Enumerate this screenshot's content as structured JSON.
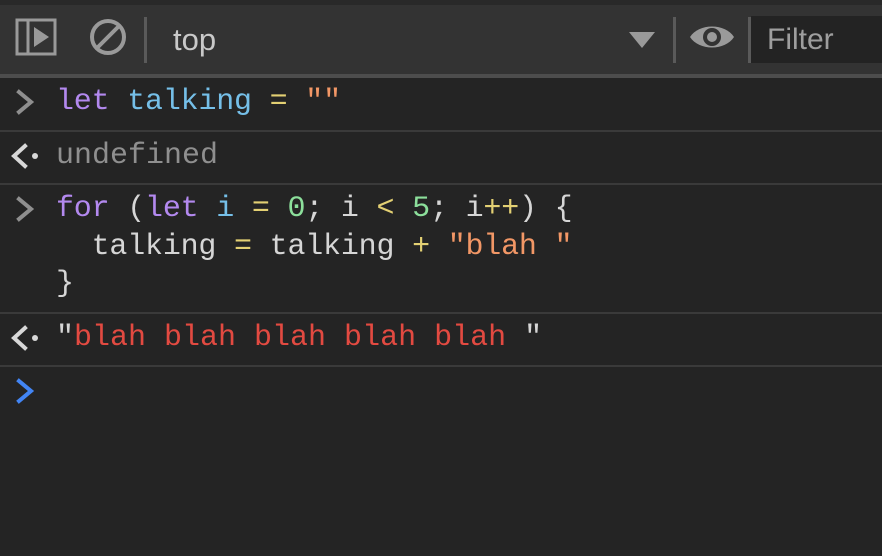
{
  "toolbar": {
    "sidebar_toggle": {
      "name": "Show console sidebar",
      "icon": "panel-play-icon"
    },
    "clear_console": {
      "name": "Clear console",
      "icon": "clear-console-icon"
    },
    "context_selector": {
      "value": "top",
      "icon": "chevron-down-icon"
    },
    "live_expression": {
      "name": "Create live expression",
      "icon": "eye-icon"
    },
    "filter": {
      "placeholder": "Filter",
      "value": ""
    }
  },
  "console": {
    "entries": [
      {
        "kind": "input",
        "marker": ">",
        "lines": [
          [
            {
              "t": "let",
              "c": "kw"
            },
            {
              "t": " ",
              "c": "plain"
            },
            {
              "t": "talking",
              "c": "ident"
            },
            {
              "t": " ",
              "c": "plain"
            },
            {
              "t": "=",
              "c": "op"
            },
            {
              "t": " ",
              "c": "plain"
            },
            {
              "t": "\"\"",
              "c": "str"
            }
          ]
        ]
      },
      {
        "kind": "output",
        "marker": "<",
        "lines": [
          [
            {
              "t": "undefined",
              "c": "muted"
            }
          ]
        ]
      },
      {
        "kind": "input",
        "marker": ">",
        "lines": [
          [
            {
              "t": "for",
              "c": "kw"
            },
            {
              "t": " (",
              "c": "plain"
            },
            {
              "t": "let",
              "c": "kw"
            },
            {
              "t": " ",
              "c": "plain"
            },
            {
              "t": "i",
              "c": "ident"
            },
            {
              "t": " ",
              "c": "plain"
            },
            {
              "t": "=",
              "c": "op"
            },
            {
              "t": " ",
              "c": "plain"
            },
            {
              "t": "0",
              "c": "num"
            },
            {
              "t": "; i ",
              "c": "plain"
            },
            {
              "t": "<",
              "c": "op"
            },
            {
              "t": " ",
              "c": "plain"
            },
            {
              "t": "5",
              "c": "num"
            },
            {
              "t": "; i",
              "c": "plain"
            },
            {
              "t": "++",
              "c": "op"
            },
            {
              "t": ") {",
              "c": "plain"
            }
          ],
          [
            {
              "t": "  talking ",
              "c": "plain"
            },
            {
              "t": "=",
              "c": "op"
            },
            {
              "t": " talking ",
              "c": "plain"
            },
            {
              "t": "+",
              "c": "op"
            },
            {
              "t": " ",
              "c": "plain"
            },
            {
              "t": "\"blah \"",
              "c": "str"
            }
          ],
          [
            {
              "t": "}",
              "c": "plain"
            }
          ]
        ]
      },
      {
        "kind": "output",
        "marker": "<",
        "lines": [
          [
            {
              "t": "\"",
              "c": "quote"
            },
            {
              "t": "blah blah blah blah blah ",
              "c": "outstr"
            },
            {
              "t": "\"",
              "c": "quote"
            }
          ]
        ]
      },
      {
        "kind": "prompt",
        "marker": ">",
        "lines": [
          []
        ]
      }
    ]
  },
  "colors": {
    "toolbar_bg": "#333333",
    "console_bg": "#242424",
    "separator": "#3a3a3a",
    "keyword": "#b389ef",
    "identifier": "#75bfe8",
    "operator": "#e3d073",
    "string": "#f29766",
    "number": "#8cdf9b",
    "plain_text": "#d6d6d6",
    "muted_text": "#8f8f8f",
    "output_string": "#e24a41",
    "active_prompt": "#4285f4"
  }
}
